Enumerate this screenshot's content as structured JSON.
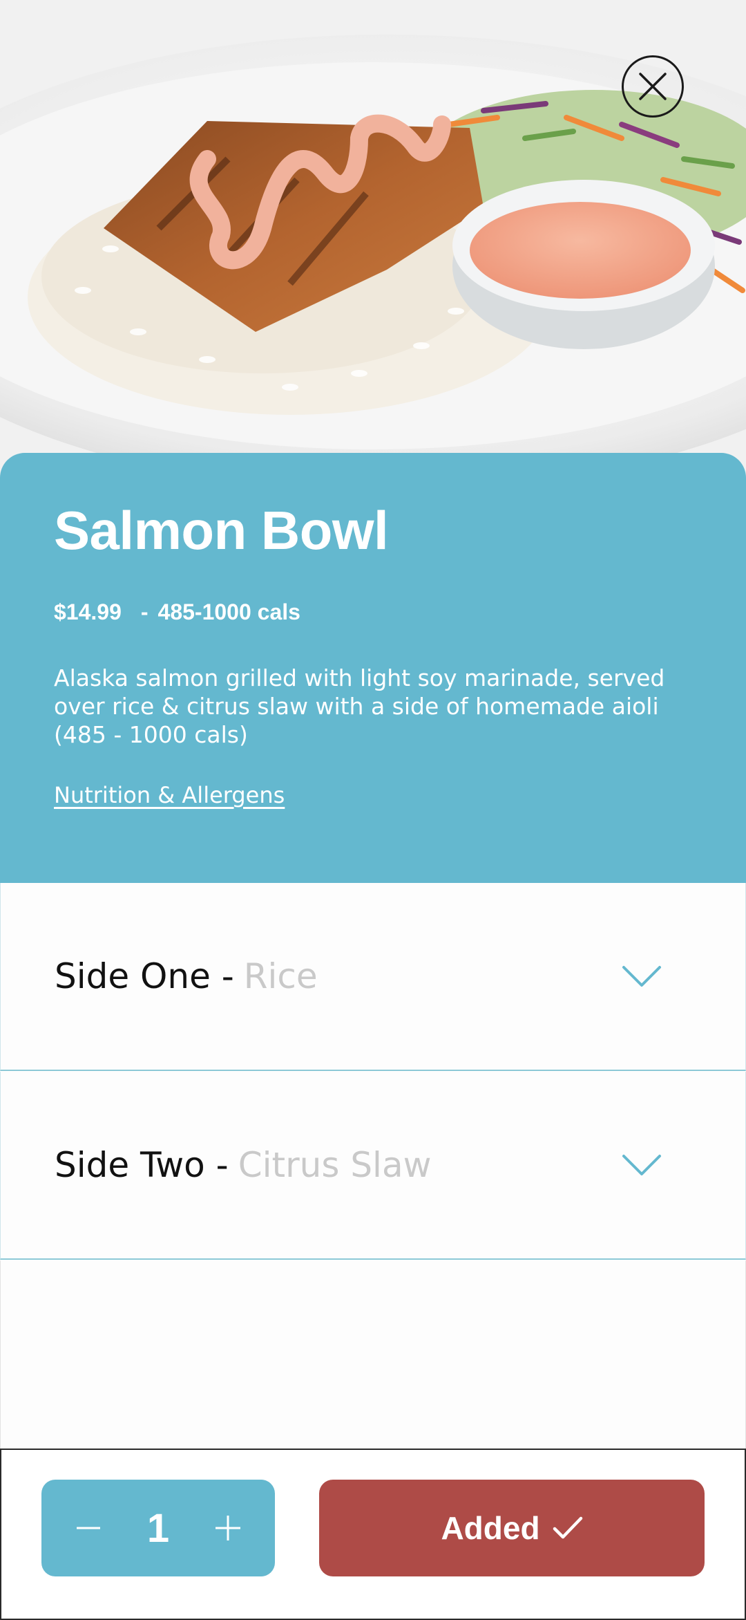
{
  "hero": {
    "image_icon": "salmon-bowl-photo",
    "close_icon": "close-icon"
  },
  "item": {
    "title": "Salmon Bowl",
    "price": "$14.99",
    "separator": "-",
    "calories": "485-1000 cals",
    "description": "Alaska salmon grilled with light soy marinade, served over rice & citrus slaw with a side of homemade aioli (485 - 1000 cals)",
    "nutrition_link": "Nutrition & Allergens"
  },
  "options": [
    {
      "label": "Side One -",
      "value": "Rice",
      "icon": "chevron-down-icon"
    },
    {
      "label": "Side Two -",
      "value": "Citrus Slaw",
      "icon": "chevron-down-icon"
    }
  ],
  "cart": {
    "quantity": "1",
    "decrement_icon": "minus-icon",
    "increment_icon": "plus-icon",
    "added_label": "Added",
    "added_icon": "check-icon"
  },
  "colors": {
    "accent_teal": "#64b8cf",
    "added_red": "#ae4b47",
    "placeholder_gray": "#c9c9c9"
  }
}
